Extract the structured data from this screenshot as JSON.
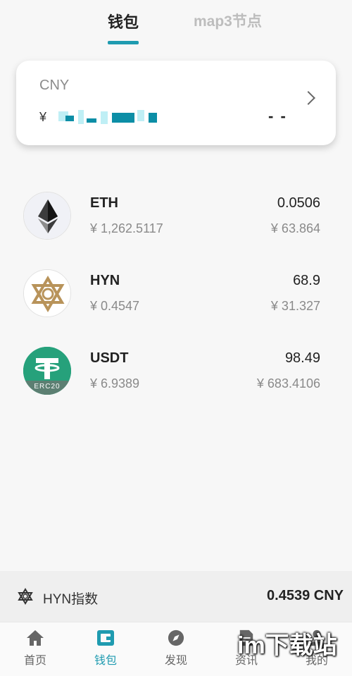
{
  "tabs": [
    {
      "label": "钱包"
    },
    {
      "label": "map3节点"
    }
  ],
  "card": {
    "currency": "CNY",
    "yen": "¥",
    "dash": "- -"
  },
  "tokens": [
    {
      "symbol": "ETH",
      "price": "¥ 1,262.5117",
      "amount": "0.0506",
      "value": "¥ 63.864",
      "icon": "ethereum-logo"
    },
    {
      "symbol": "HYN",
      "price": "¥ 0.4547",
      "amount": "68.9",
      "value": "¥ 31.327",
      "icon": "hyperion-logo"
    },
    {
      "symbol": "USDT",
      "price": "¥ 6.9389",
      "amount": "98.49",
      "value": "¥ 683.4106",
      "icon": "tether-logo",
      "badge": "ERC20"
    }
  ],
  "index": {
    "label": "HYN指数",
    "value": "0.4539 CNY"
  },
  "nav": [
    {
      "label": "首页",
      "icon": "home-icon"
    },
    {
      "label": "钱包",
      "icon": "wallet-icon"
    },
    {
      "label": "发现",
      "icon": "compass-icon"
    },
    {
      "label": "资讯",
      "icon": "document-icon"
    },
    {
      "label": "我的",
      "icon": "person-icon"
    }
  ],
  "watermark": "im下载站",
  "colors": {
    "accent": "#1f9bb0",
    "tether": "#26a17b"
  }
}
